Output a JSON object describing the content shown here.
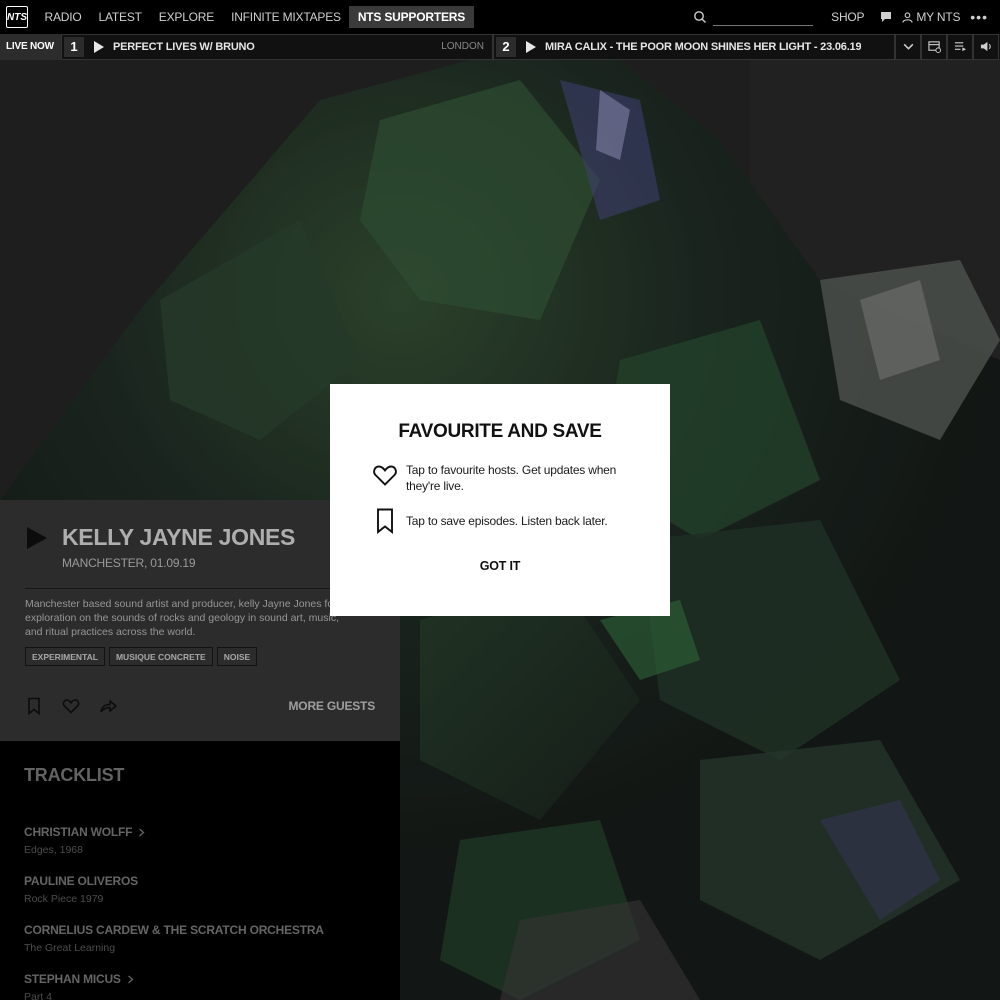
{
  "nav": {
    "logo_text": "NTS",
    "items": [
      {
        "label": "RADIO"
      },
      {
        "label": "LATEST"
      },
      {
        "label": "EXPLORE"
      },
      {
        "label": "INFINITE MIXTAPES"
      },
      {
        "label": "NTS SUPPORTERS",
        "active": true
      }
    ],
    "search_placeholder": "",
    "shop_label": "SHOP",
    "my_nts_label": "MY NTS"
  },
  "live": {
    "label": "LIVE NOW",
    "channel1": {
      "number": "1",
      "title": "PERFECT LIVES W/ BRUNO",
      "location": "LONDON"
    },
    "channel2": {
      "number": "2",
      "title": "MIRA CALIX - THE POOR MOON SHINES HER LIGHT - 23.06.19"
    }
  },
  "episode": {
    "title": "KELLY JAYNE JONES",
    "subtitle": "MANCHESTER, 01.09.19",
    "description": "Manchester based sound artist and producer, kelly Jayne Jones for an exploration on the sounds of rocks and geology in sound art, music, and ritual practices across the world.",
    "tags": [
      "EXPERIMENTAL",
      "MUSIQUE CONCRETE",
      "NOISE"
    ],
    "more_guests_label": "MORE GUESTS"
  },
  "tracklist": {
    "heading": "TRACKLIST",
    "tracks": [
      {
        "artist": "CHRISTIAN WOLFF",
        "title": "Edges, 1968",
        "has_link": true
      },
      {
        "artist": "PAULINE OLIVEROS",
        "title": "Rock Piece 1979",
        "has_link": false
      },
      {
        "artist": "CORNELIUS CARDEW & THE SCRATCH ORCHESTRA",
        "title": "The Great Learning",
        "has_link": false
      },
      {
        "artist": "STEPHAN MICUS",
        "title": "Part 4",
        "has_link": true
      }
    ]
  },
  "modal": {
    "title": "FAVOURITE AND SAVE",
    "favourite_text": "Tap to favourite hosts. Get updates when they're live.",
    "save_text": "Tap to save episodes. Listen back later.",
    "button_label": "GOT IT"
  },
  "colors": {
    "nav_bg": "#000000",
    "card_bg": "#3d3d3d",
    "modal_bg": "#ffffff",
    "active_tab_bg": "#3a3a3a"
  }
}
